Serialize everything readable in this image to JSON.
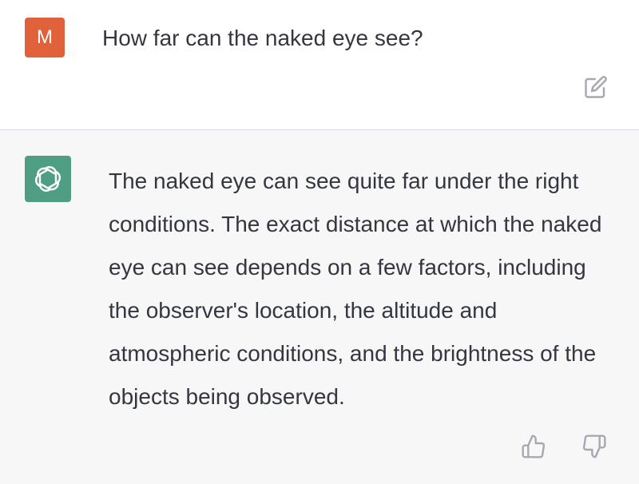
{
  "user_message": {
    "avatar_initial": "M",
    "text": "How far can the naked eye see?",
    "avatar_color": "#e0623a",
    "edit_icon": "pencil-square-icon"
  },
  "assistant_message": {
    "avatar_icon": "openai-logo-icon",
    "avatar_color": "#4f9e84",
    "text": "The naked eye can see quite far under the right conditions. The exact distance at which the naked eye can see depends on a few factors, including the observer's location, the altitude and atmospheric conditions, and the brightness of the objects being observed.",
    "feedback_icons": [
      "thumbs-up-icon",
      "thumbs-down-icon"
    ]
  }
}
